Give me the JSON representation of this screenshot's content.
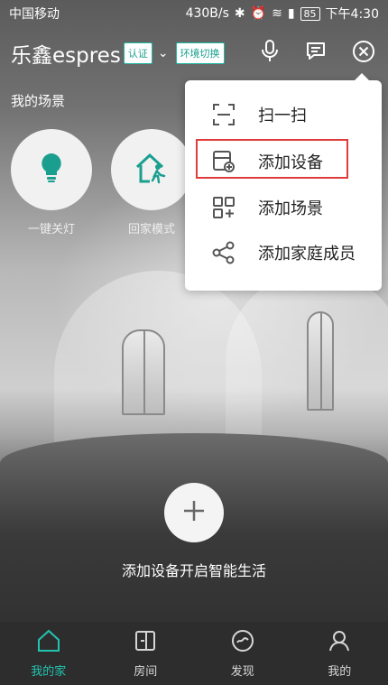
{
  "status_bar": {
    "carrier": "中国移动",
    "speed": "430B/s",
    "battery": "85",
    "time": "下午4:30"
  },
  "header": {
    "home_name": "乐鑫espres",
    "verify_tag": "认证",
    "env_switch_tag": "环境切换"
  },
  "scenes": {
    "title": "我的场景",
    "items": [
      {
        "label": "一键关灯",
        "icon": "lightbulb-icon"
      },
      {
        "label": "回家模式",
        "icon": "home-walk-icon"
      }
    ]
  },
  "menu": {
    "items": [
      {
        "label": "扫一扫",
        "icon": "scan-icon"
      },
      {
        "label": "添加设备",
        "icon": "add-device-icon"
      },
      {
        "label": "添加场景",
        "icon": "add-scene-icon"
      },
      {
        "label": "添加家庭成员",
        "icon": "share-member-icon"
      }
    ]
  },
  "main": {
    "add_text": "添加设备开启智能生活"
  },
  "nav": {
    "tabs": [
      {
        "label": "我的家",
        "icon": "home-icon",
        "active": true
      },
      {
        "label": "房间",
        "icon": "room-icon",
        "active": false
      },
      {
        "label": "发现",
        "icon": "discover-icon",
        "active": false
      },
      {
        "label": "我的",
        "icon": "profile-icon",
        "active": false
      }
    ]
  },
  "colors": {
    "accent": "#22c4b0",
    "highlight": "#e03c3c",
    "nav_bg": "#2d2d2d"
  }
}
